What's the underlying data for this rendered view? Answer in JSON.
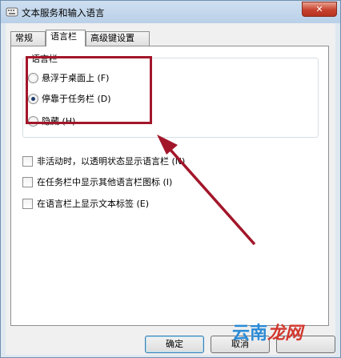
{
  "window": {
    "title": "文本服务和输入语言",
    "close_glyph": "✕"
  },
  "tabs": [
    {
      "label": "常规",
      "selected": false
    },
    {
      "label": "语言栏",
      "selected": true
    },
    {
      "label": "高级键设置",
      "selected": false
    }
  ],
  "language_bar_group": {
    "legend": "语言栏",
    "options": [
      {
        "label": "悬浮于桌面上 (F)",
        "checked": false
      },
      {
        "label": "停靠于任务栏 (D)",
        "checked": true
      },
      {
        "label": "隐藏 (H)",
        "checked": false
      }
    ]
  },
  "checkboxes": [
    {
      "label": "非活动时，以透明状态显示语言栏 (N)",
      "checked": false
    },
    {
      "label": "在任务栏中显示其他语言栏图标 (I)",
      "checked": false
    },
    {
      "label": "在语言栏上显示文本标签 (E)",
      "checked": false
    }
  ],
  "buttons": {
    "ok": "确定",
    "cancel": "取消",
    "apply": ""
  },
  "watermark": {
    "part_a": "云南",
    "part_b": "龙网"
  },
  "colors": {
    "annotation": "#a3162a",
    "watermark_blue": "#2a8bd6",
    "watermark_red": "#d2372e"
  }
}
